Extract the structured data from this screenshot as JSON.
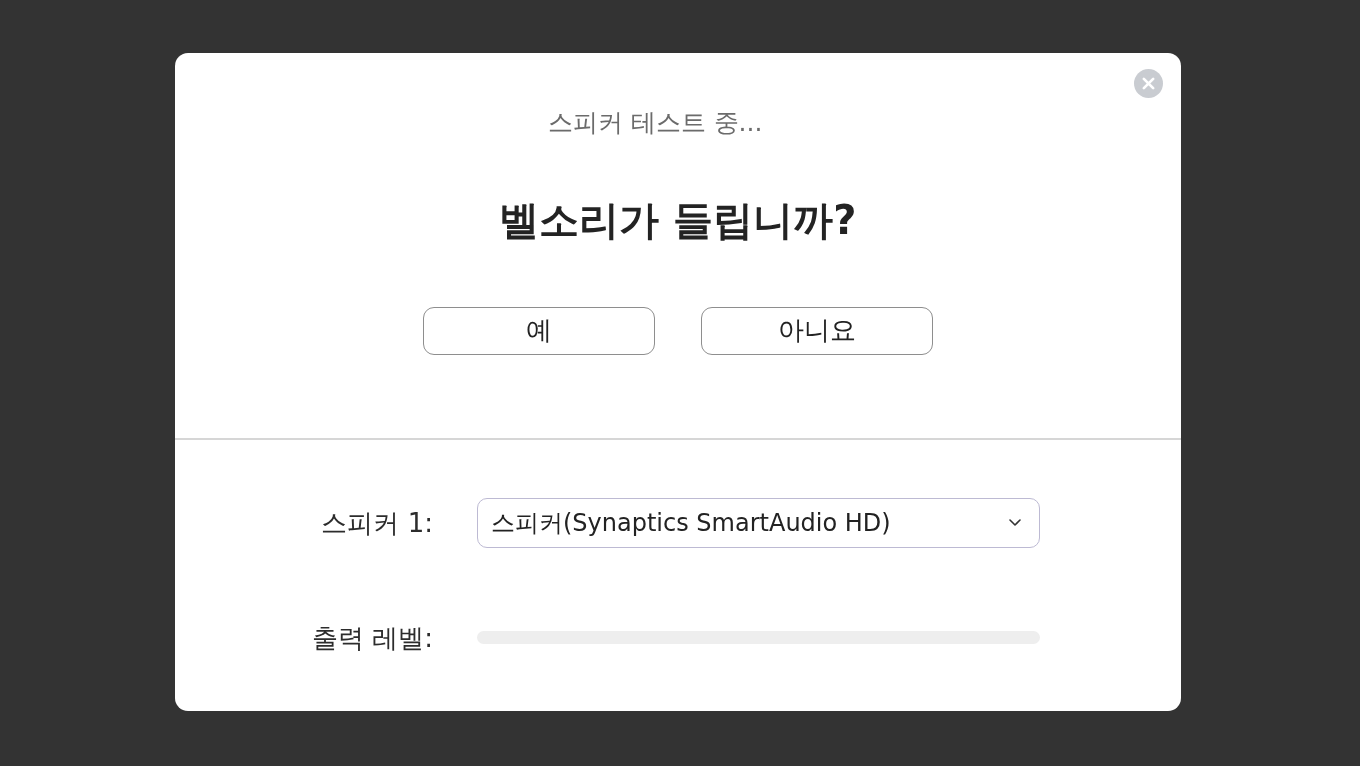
{
  "dialog": {
    "status": "스피커 테스트 중...",
    "question": "벨소리가 들립니까?",
    "buttons": [
      "예",
      "아니요"
    ],
    "speaker": {
      "label": "스피커 1:",
      "value": "스피커(Synaptics SmartAudio HD)"
    },
    "output_level": {
      "label": "출력 레벨:",
      "level": 0
    }
  }
}
